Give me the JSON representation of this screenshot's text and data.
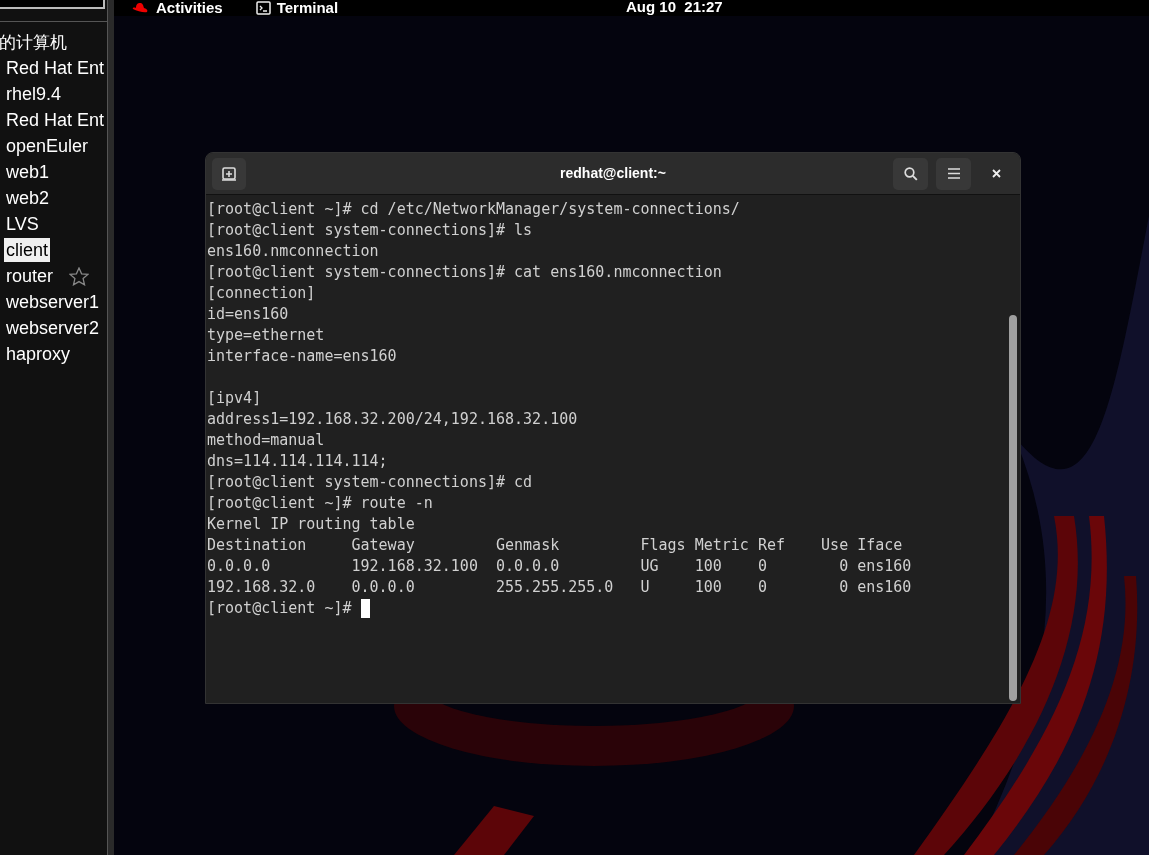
{
  "sidebar": {
    "heading": "的计算机",
    "items": [
      {
        "label": "Red Hat Ent",
        "selected": false,
        "starred": false
      },
      {
        "label": "rhel9.4",
        "selected": false,
        "starred": false
      },
      {
        "label": "Red Hat Ent",
        "selected": false,
        "starred": false
      },
      {
        "label": "openEuler",
        "selected": false,
        "starred": false
      },
      {
        "label": "web1",
        "selected": false,
        "starred": false
      },
      {
        "label": "web2",
        "selected": false,
        "starred": false
      },
      {
        "label": "LVS",
        "selected": false,
        "starred": false
      },
      {
        "label": "client",
        "selected": true,
        "starred": false
      },
      {
        "label": "router",
        "selected": false,
        "starred": true
      },
      {
        "label": "webserver1",
        "selected": false,
        "starred": false
      },
      {
        "label": "webserver2",
        "selected": false,
        "starred": false
      },
      {
        "label": "haproxy",
        "selected": false,
        "starred": false
      }
    ]
  },
  "top_bar": {
    "activities": "Activities",
    "app": "Terminal",
    "clock": "Aug 10  21:27"
  },
  "terminal": {
    "title": "redhat@client:~",
    "blocks": [
      [
        "[root@client ~]# cd /etc/NetworkManager/system-connections/",
        "[root@client system-connections]# ls",
        "ens160.nmconnection",
        "[root@client system-connections]# cat ens160.nmconnection",
        "[connection]",
        "id=ens160",
        "type=ethernet",
        "interface-name=ens160"
      ],
      [
        "[ipv4]",
        "address1=192.168.32.200/24,192.168.32.100",
        "method=manual",
        "dns=114.114.114.114;",
        "[root@client system-connections]# cd",
        "[root@client ~]# route -n",
        "Kernel IP routing table",
        "Destination     Gateway         Genmask         Flags Metric Ref    Use Iface",
        "0.0.0.0         192.168.32.100  0.0.0.0         UG    100    0        0 ens160",
        "192.168.32.0    0.0.0.0         255.255.255.0   U     100    0        0 ens160"
      ]
    ],
    "prompt": "[root@client ~]#"
  }
}
